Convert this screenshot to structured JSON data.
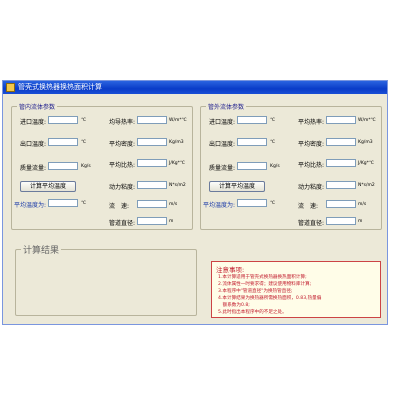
{
  "window": {
    "title": "管壳式换热器换热面积计算"
  },
  "tube_side": {
    "label": "管内流体参数",
    "inlet_temp": {
      "label": "进口温度:",
      "unit": "℃"
    },
    "outlet_temp": {
      "label": "出口温度:",
      "unit": "℃"
    },
    "mass_flow": {
      "label": "质量流量:",
      "unit": "Kg/s"
    },
    "calc_button": "计算平均温度",
    "avg_temp": {
      "label": "平均温度为:",
      "unit": "℃"
    },
    "thermal_cond": {
      "label": "均导热率:",
      "unit": "W/m*℃"
    },
    "density": {
      "label": "平均密度:",
      "unit": "Kg/m3"
    },
    "specific_heat": {
      "label": "平均比热:",
      "unit": "J/Kg*℃"
    },
    "viscosity": {
      "label": "动力粘度:",
      "unit": "N*s/m2"
    },
    "velocity": {
      "label": "流　速:",
      "unit": "m/s"
    },
    "diameter": {
      "label": "管道直径:",
      "unit": "m"
    }
  },
  "shell_side": {
    "label": "管外流体参数",
    "inlet_temp": {
      "label": "进口温度:",
      "unit": "℃"
    },
    "outlet_temp": {
      "label": "出口温度:",
      "unit": "℃"
    },
    "mass_flow": {
      "label": "质量流量:",
      "unit": "Kg/s"
    },
    "calc_button": "计算平均温度",
    "avg_temp": {
      "label": "平均温度为:",
      "unit": "℃"
    },
    "thermal_cond": {
      "label": "平均热率:",
      "unit": "W/m*℃"
    },
    "density": {
      "label": "平均密度:",
      "unit": "Kg/m3"
    },
    "specific_heat": {
      "label": "平均比热:",
      "unit": "J/Kg*℃"
    },
    "viscosity": {
      "label": "动力粘度:",
      "unit": "N*s/m2"
    },
    "velocity": {
      "label": "流　速:",
      "unit": "m/s"
    },
    "diameter": {
      "label": "管道直径:",
      "unit": "m"
    }
  },
  "result": {
    "label": "计算结果"
  },
  "notes": {
    "title": "注意事项:",
    "lines": [
      "1.本计算适用于管壳式换热器换热面积计算;",
      "2.流体属性一时要求得；建议使用物料库计算;",
      "3.本程序中\"管道直径\"为换热管直径;",
      "4.本计算结果为换热器所需换热面积，0.83,热量偏",
      "　额系数为0.8;",
      "5.此时指出本程序中的不足之处。"
    ]
  },
  "colors": {
    "title_bar": "#0a3cc8",
    "panel_bg": "#ece9d8",
    "notes_text": "#c0182a"
  }
}
